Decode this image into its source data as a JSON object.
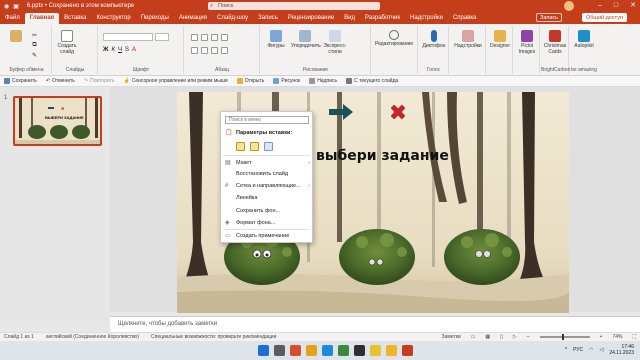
{
  "titlebar": {
    "title": "6.pptx • Сохранено в этом компьютере",
    "search_placeholder": "Поиск"
  },
  "menu": {
    "tabs": [
      "Файл",
      "Главная",
      "Вставка",
      "Конструктор",
      "Переходы",
      "Анимация",
      "Слайд-шоу",
      "Запись",
      "Рецензирование",
      "Вид",
      "Разработчик",
      "Надстройки",
      "Справка"
    ],
    "record_label": "Запись",
    "share_label": "Общий доступ"
  },
  "ribbon": {
    "clipboard": "Буфер обмена",
    "create_slide": "Создать слайд",
    "slides": "Слайды",
    "font": "Шрифт",
    "paragraph": "Абзац",
    "figures": "Фигуры",
    "arrange": "Упорядочить",
    "express_styles": "Экспресс-стили",
    "drawing": "Рисование",
    "editing": "Редактирование",
    "dictate": "Диктофон",
    "voice": "Голос",
    "addins": "Надстройки",
    "designer": "Designer",
    "pickit": "Pickit Images",
    "christmas": "Christmas Cards",
    "autopilot": "Autopilot",
    "brightcarbon": "BrightCarbon",
    "beamazing": "be amazing"
  },
  "qabar": {
    "items": [
      "Сохранить",
      "Отменить",
      "Повторить",
      "Сенсорное управление или режим мыши",
      "Открыть",
      "Рисунок",
      "Надпись",
      "С текущего слайда"
    ]
  },
  "thumbpane": {
    "slide_number": "1",
    "thumb_text": "ВЫБЕРИ ЗАДАНИЕ"
  },
  "slide": {
    "title": "выбери задание"
  },
  "context_menu": {
    "search_placeholder": "Поиск в меню",
    "paste_header": "Параметры вставки:",
    "items": [
      "Макет",
      "Восстановить слайд",
      "Сетка и направляющие...",
      "Линейка",
      "Сохранить фон...",
      "Формат фона...",
      "Создать примечание"
    ]
  },
  "notes": {
    "placeholder": "Щелкните, чтобы добавить заметки"
  },
  "statusbar": {
    "slide_info": "Слайд 1 из 1",
    "language": "английский (Соединенное Королевство)",
    "accessibility": "Специальные возможности: проверьте рекомендации",
    "notes_btn": "Заметки",
    "zoom": "74%"
  },
  "taskbar": {
    "lang": "РУС",
    "time": "17:46",
    "date": "24.11.2023"
  },
  "colors": {
    "accent": "#c43e1c",
    "teal_arrow": "#1e4f5c",
    "red_cross": "#c0282e"
  }
}
